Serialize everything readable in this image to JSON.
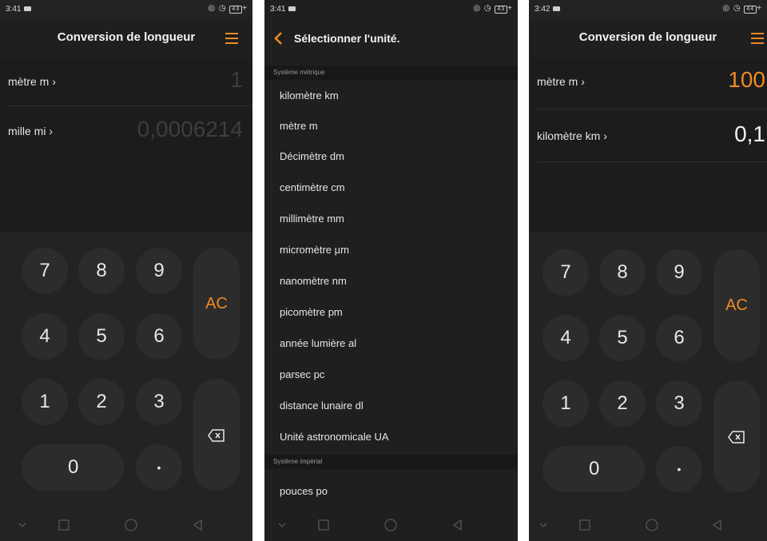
{
  "colors": {
    "accent": "#f08a24",
    "bg": "#232323",
    "display_bg": "#1c1c1c",
    "key_bg": "#2c2c2c"
  },
  "screen1": {
    "status_time": "3:41",
    "battery": "43",
    "title": "Conversion de longueur",
    "from_unit": "mètre m ›",
    "from_value": "1",
    "to_unit": "mille mi ›",
    "to_value": "0,0006214"
  },
  "screen2": {
    "status_time": "3:41",
    "battery": "43",
    "title": "Sélectionner l'unité.",
    "section_metric": "Système métrique",
    "metric_units": [
      "kilomètre km",
      "mètre m",
      "Décimètre dm",
      "centimètre cm",
      "millimètre mm",
      "micromètre µm",
      "nanomètre nm",
      "picomètre pm",
      "année lumière al",
      "parsec pc",
      "distance lunaire dl",
      "Unité astronomicale UA"
    ],
    "section_imperial": "Système impérial",
    "imperial_units": [
      "pouces po"
    ]
  },
  "screen3": {
    "status_time": "3:42",
    "battery": "44",
    "title": "Conversion de longueur",
    "from_unit": "mètre m ›",
    "from_value": "100",
    "to_unit": "kilomètre km ›",
    "to_value": "0,1"
  },
  "keypad": {
    "k7": "7",
    "k8": "8",
    "k9": "9",
    "k4": "4",
    "k5": "5",
    "k6": "6",
    "k1": "1",
    "k2": "2",
    "k3": "3",
    "k0": "0",
    "dot": "•",
    "ac": "AC"
  },
  "icons": [
    "menu-icon",
    "back-chevron-icon",
    "backspace-icon",
    "nav-down-icon",
    "nav-recents-icon",
    "nav-home-icon",
    "nav-back-icon"
  ]
}
